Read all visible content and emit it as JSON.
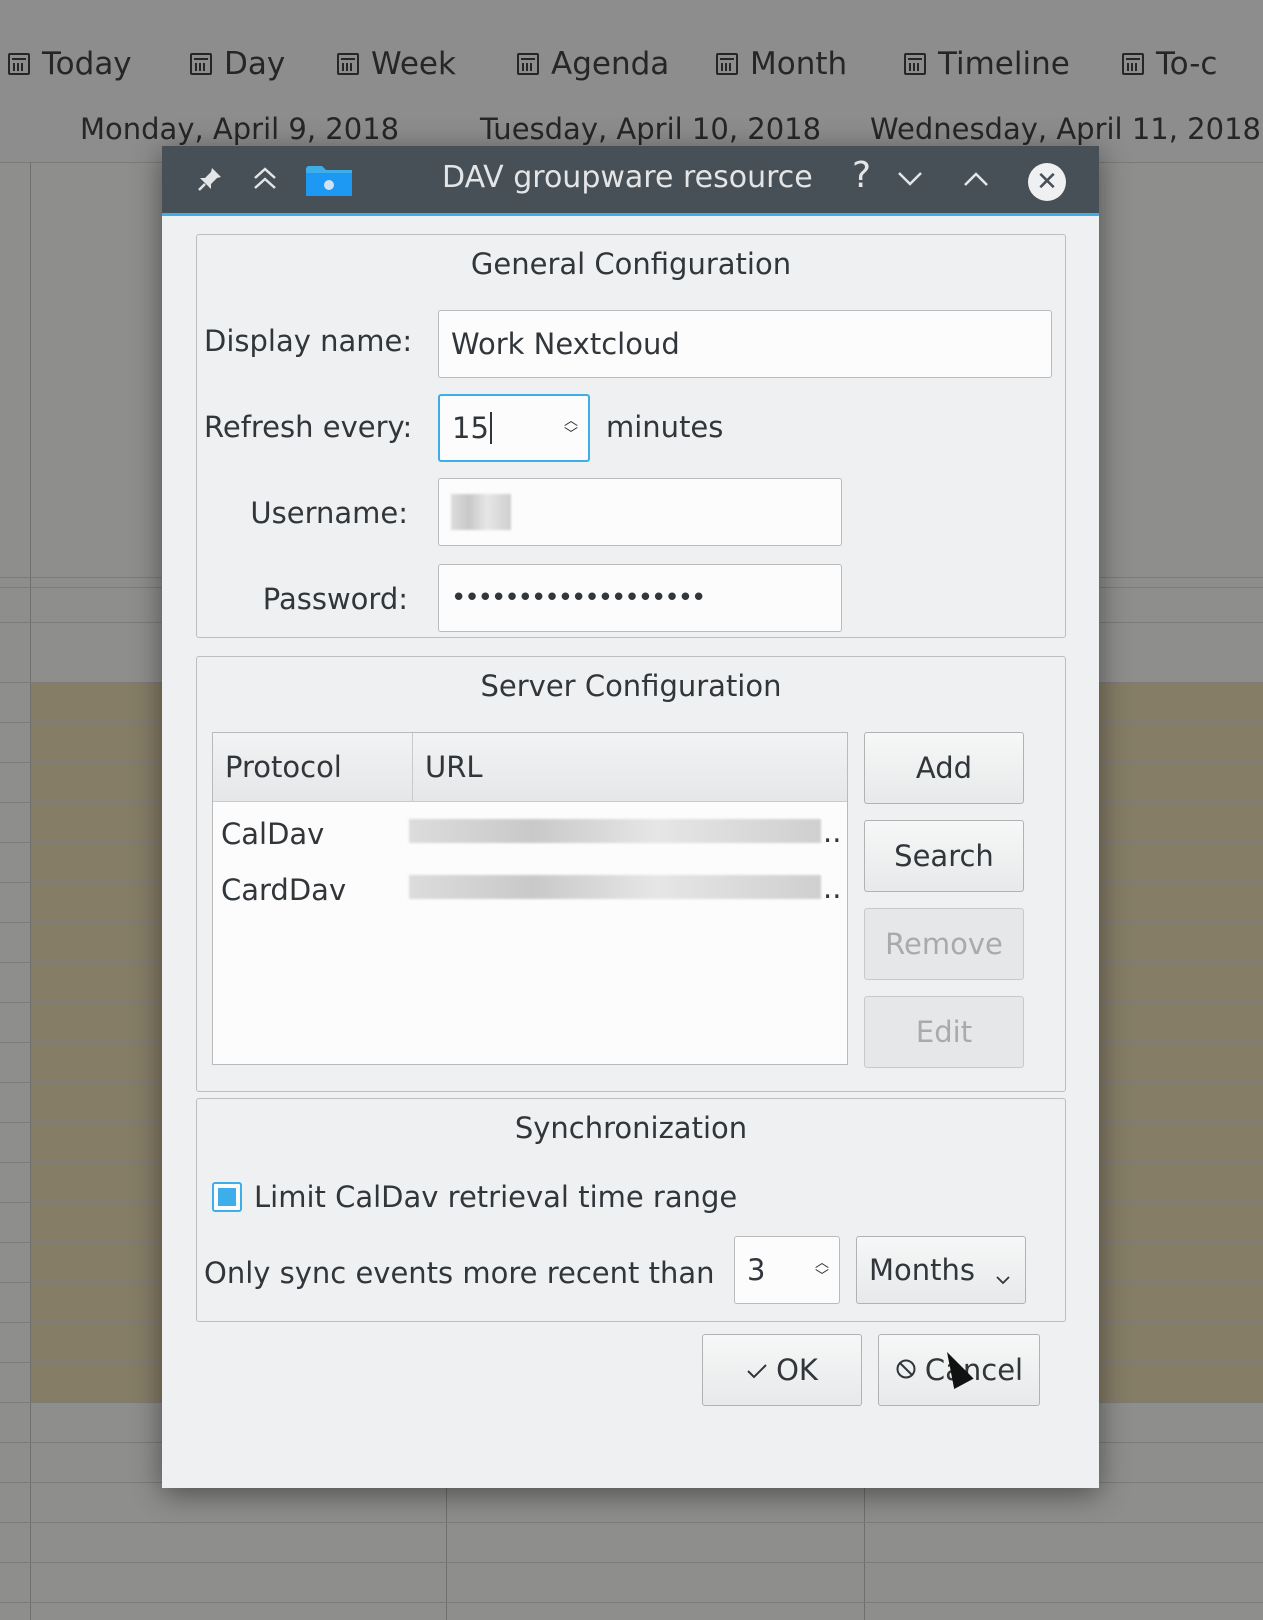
{
  "toolbar": {
    "items": [
      {
        "label": "Today",
        "icon": "calendar-today-icon"
      },
      {
        "label": "Day",
        "icon": "calendar-day-icon"
      },
      {
        "label": "Week",
        "icon": "calendar-week-icon"
      },
      {
        "label": "Agenda",
        "icon": "agenda-icon"
      },
      {
        "label": "Month",
        "icon": "calendar-month-icon"
      },
      {
        "label": "Timeline",
        "icon": "timeline-icon"
      },
      {
        "label": "To-c",
        "icon": "todo-icon"
      }
    ]
  },
  "calendar": {
    "dates": [
      "Monday, April 9, 2018",
      "Tuesday, April 10, 2018",
      "Wednesday, April 11, 2018"
    ]
  },
  "dialog": {
    "title": "DAV groupware resource",
    "title_icons": [
      "pin-icon",
      "keep-above-icon",
      "folder-icon",
      "help-icon",
      "minimize-icon",
      "maximize-icon",
      "close-icon"
    ],
    "general": {
      "title": "General Configuration",
      "display_name_label": "Display name:",
      "display_name_value": "Work Nextcloud",
      "refresh_label": "Refresh every:",
      "refresh_value": "15",
      "refresh_unit": "minutes",
      "username_label": "Username:",
      "password_label": "Password:",
      "password_value": "•••••••••••••••••••"
    },
    "server": {
      "title": "Server Configuration",
      "columns": [
        "Protocol",
        "URL"
      ],
      "rows": [
        {
          "protocol": "CalDav",
          "url_suffix": ".."
        },
        {
          "protocol": "CardDav",
          "url_suffix": ".."
        }
      ],
      "buttons": {
        "add": "Add",
        "search": "Search",
        "remove": "Remove",
        "edit": "Edit"
      }
    },
    "sync": {
      "title": "Synchronization",
      "limit_label": "Limit CalDav retrieval time range",
      "limit_checked": true,
      "only_sync_label": "Only sync events more recent than",
      "only_sync_value": "3",
      "unit_selected": "Months"
    },
    "ok_label": "OK",
    "cancel_label": "Cancel"
  },
  "colors": {
    "accent": "#3daee9",
    "titlebar": "#475057",
    "dialog_bg": "#eff0f1",
    "calendar_busy": "#857d66"
  }
}
